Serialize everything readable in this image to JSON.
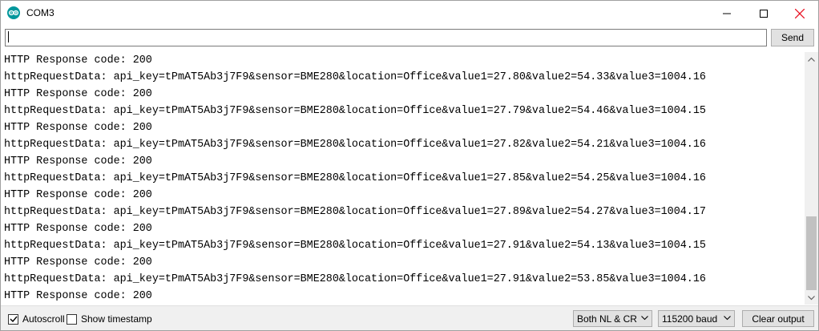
{
  "window": {
    "title": "COM3",
    "app_icon": "arduino-logo-icon",
    "controls": [
      "minimize-icon",
      "maximize-icon",
      "close-icon"
    ]
  },
  "send_bar": {
    "input_value": "",
    "send_label": "Send"
  },
  "output": {
    "lines": [
      "HTTP Response code: 200",
      "httpRequestData: api_key=tPmAT5Ab3j7F9&sensor=BME280&location=Office&value1=27.80&value2=54.33&value3=1004.16",
      "HTTP Response code: 200",
      "httpRequestData: api_key=tPmAT5Ab3j7F9&sensor=BME280&location=Office&value1=27.79&value2=54.46&value3=1004.15",
      "HTTP Response code: 200",
      "httpRequestData: api_key=tPmAT5Ab3j7F9&sensor=BME280&location=Office&value1=27.82&value2=54.21&value3=1004.16",
      "HTTP Response code: 200",
      "httpRequestData: api_key=tPmAT5Ab3j7F9&sensor=BME280&location=Office&value1=27.85&value2=54.25&value3=1004.16",
      "HTTP Response code: 200",
      "httpRequestData: api_key=tPmAT5Ab3j7F9&sensor=BME280&location=Office&value1=27.89&value2=54.27&value3=1004.17",
      "HTTP Response code: 200",
      "httpRequestData: api_key=tPmAT5Ab3j7F9&sensor=BME280&location=Office&value1=27.91&value2=54.13&value3=1004.15",
      "HTTP Response code: 200",
      "httpRequestData: api_key=tPmAT5Ab3j7F9&sensor=BME280&location=Office&value1=27.91&value2=53.85&value3=1004.16",
      "HTTP Response code: 200"
    ]
  },
  "bottom_bar": {
    "autoscroll_label": "Autoscroll",
    "autoscroll_checked": true,
    "timestamp_label": "Show timestamp",
    "timestamp_checked": false,
    "line_ending": "Both NL & CR",
    "baud_rate": "115200 baud",
    "clear_label": "Clear output"
  },
  "colors": {
    "app_icon": "#00979c",
    "close_icon": "#e81123",
    "button_bg": "#e1e1e1",
    "bar_bg": "#f0f0f0"
  }
}
